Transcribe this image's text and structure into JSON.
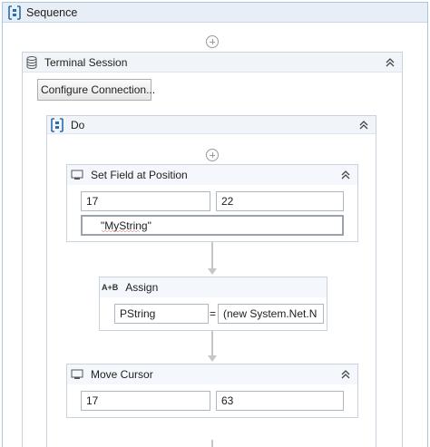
{
  "sequence": {
    "title": "Sequence",
    "icon": "sequence-icon"
  },
  "terminal_session": {
    "title": "Terminal Session",
    "icon": "database-icon",
    "configure_button": "Configure Connection..."
  },
  "do_scope": {
    "title": "Do",
    "icon": "sequence-icon"
  },
  "set_field": {
    "title": "Set Field at Position",
    "icon": "terminal-icon",
    "row_value": "17",
    "column_value": "22",
    "text_value": "\"MyString\""
  },
  "assign": {
    "title": "Assign",
    "icon": "assign-icon",
    "to_value": "PString",
    "operator": "=",
    "expression_value": "(new System.Net.N"
  },
  "move_cursor": {
    "title": "Move Cursor",
    "icon": "terminal-icon",
    "row_value": "17",
    "column_value": "63"
  },
  "colors": {
    "header_bg": "#e8eef6",
    "border": "#a9c4de",
    "accent_icon": "#2b6cb0"
  }
}
